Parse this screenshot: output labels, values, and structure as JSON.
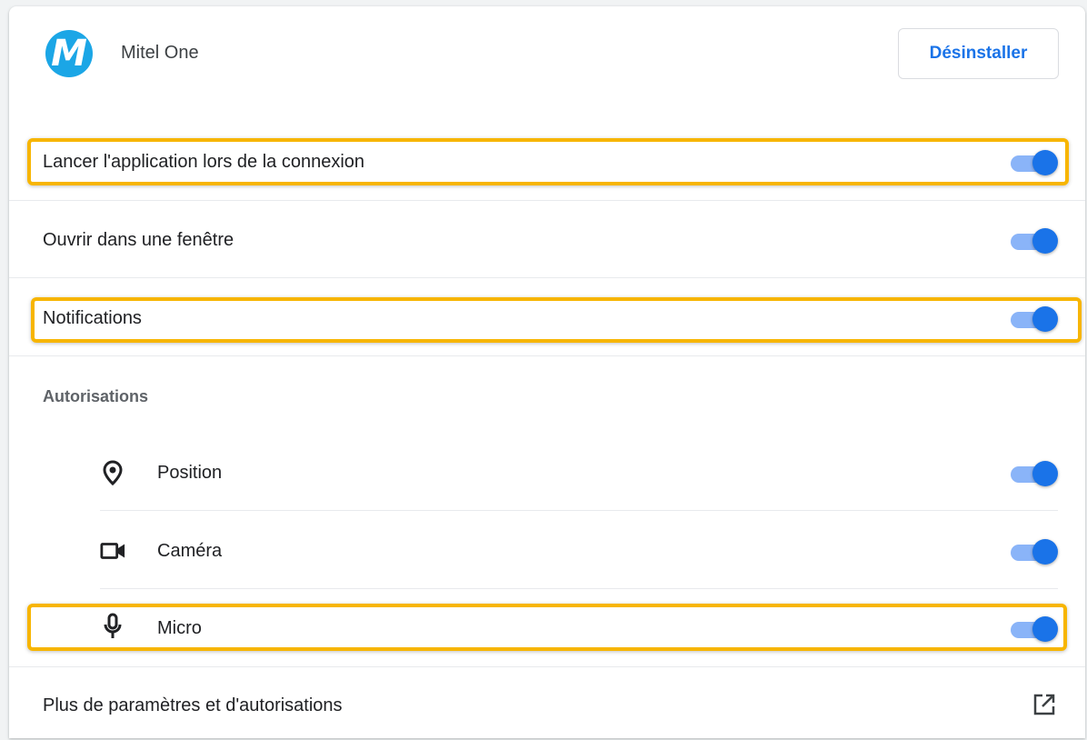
{
  "app": {
    "name": "Mitel One",
    "logo_letter": "M",
    "uninstall_label": "Désinstaller"
  },
  "settings": [
    {
      "label": "Lancer l'application lors de la connexion",
      "enabled": true,
      "highlighted": true
    },
    {
      "label": "Ouvrir dans une fenêtre",
      "enabled": true,
      "highlighted": false
    },
    {
      "label": "Notifications",
      "enabled": true,
      "highlighted": true
    }
  ],
  "permissions": {
    "title": "Autorisations",
    "items": [
      {
        "label": "Position",
        "icon": "location-pin-icon",
        "enabled": true,
        "highlighted": false
      },
      {
        "label": "Caméra",
        "icon": "video-camera-icon",
        "enabled": true,
        "highlighted": false
      },
      {
        "label": "Micro",
        "icon": "microphone-icon",
        "enabled": true,
        "highlighted": true
      }
    ]
  },
  "more_settings": {
    "label": "Plus de paramètres et d'autorisations",
    "icon": "open-external-icon"
  },
  "colors": {
    "accent": "#1a73e8",
    "toggle_track": "#8ab4f8",
    "highlight": "#f7b500",
    "logo": "#1ba6e6"
  }
}
